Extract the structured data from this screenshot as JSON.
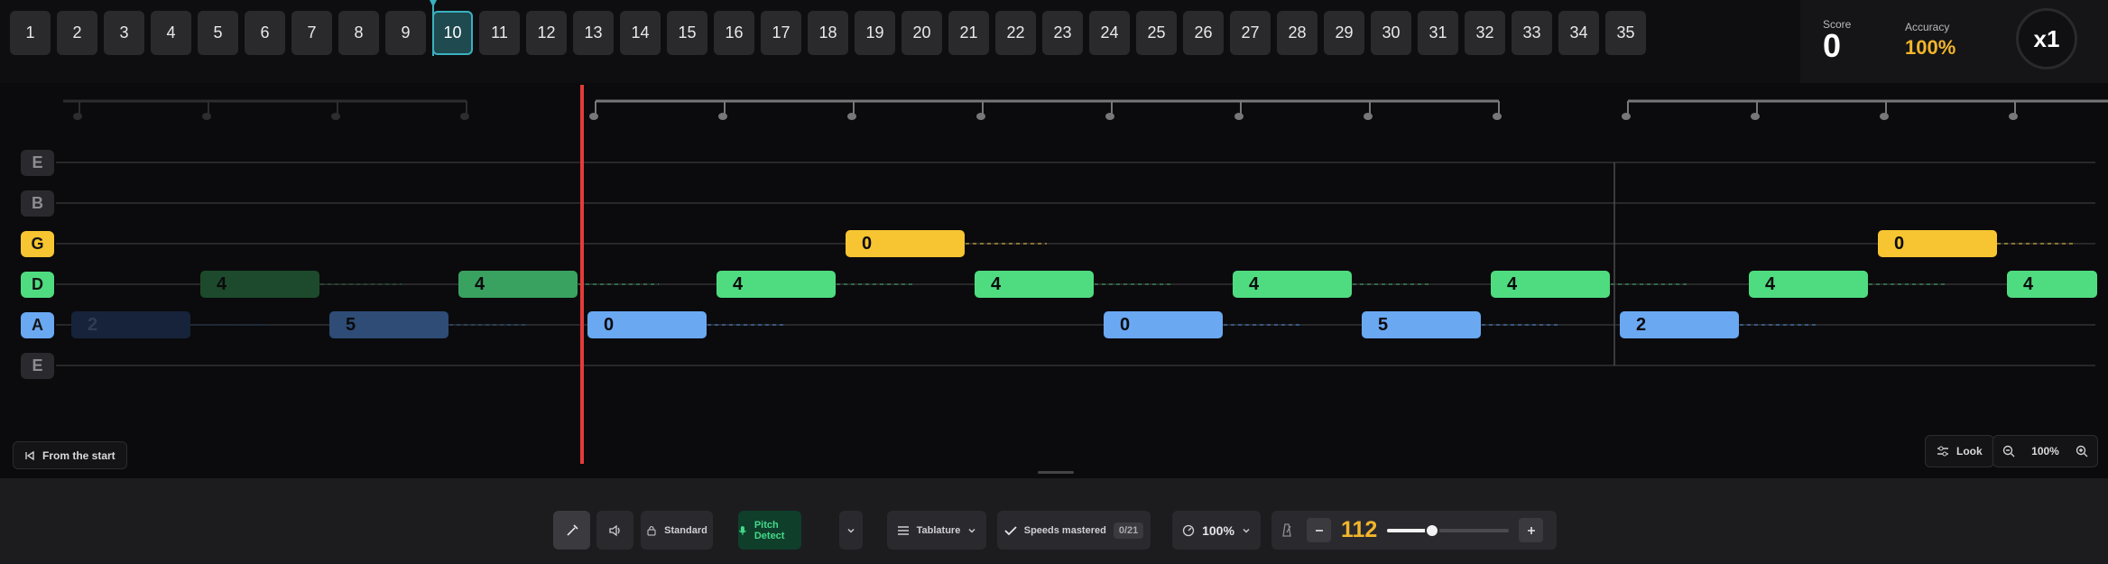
{
  "measures": [
    "1",
    "2",
    "3",
    "4",
    "5",
    "6",
    "7",
    "8",
    "9",
    "10",
    "11",
    "12",
    "13",
    "14",
    "15",
    "16",
    "17",
    "18",
    "19",
    "20",
    "21",
    "22",
    "23",
    "24",
    "25",
    "26",
    "27",
    "28",
    "29",
    "30",
    "31",
    "32",
    "33",
    "34",
    "35"
  ],
  "active_measure": "10",
  "score": {
    "score_label": "Score",
    "score_value": "0",
    "accuracy_label": "Accuracy",
    "accuracy_value": "100%",
    "multiplier": "x1"
  },
  "strings": [
    "E",
    "B",
    "G",
    "D",
    "A",
    "E"
  ],
  "notes": [
    "2",
    "5",
    "4",
    "4",
    "0",
    "4",
    "0",
    "4",
    "0",
    "4",
    "5",
    "4",
    "2",
    "4",
    "0",
    "4"
  ],
  "view": {
    "from_start": "From the start",
    "look": "Look",
    "zoom": "100%"
  },
  "toolbar": {
    "tuning": "Standard",
    "pitch_detect": "Pitch Detect",
    "notation": "Tablature",
    "speeds_mastered": "Speeds mastered",
    "speeds_count": "0/21",
    "playback_speed": "100%",
    "bpm": "112",
    "bpm_slider_fraction": 0.37
  },
  "colors": {
    "accent_teal": "#3ab1bf",
    "playhead": "#e53b3b",
    "yellow_note": "#f7c531",
    "green_note": "#4fdc80",
    "blue_note": "#6aa8f2",
    "accuracy": "#f3b52b",
    "pitch_detect_bg": "#0f3e2b"
  }
}
